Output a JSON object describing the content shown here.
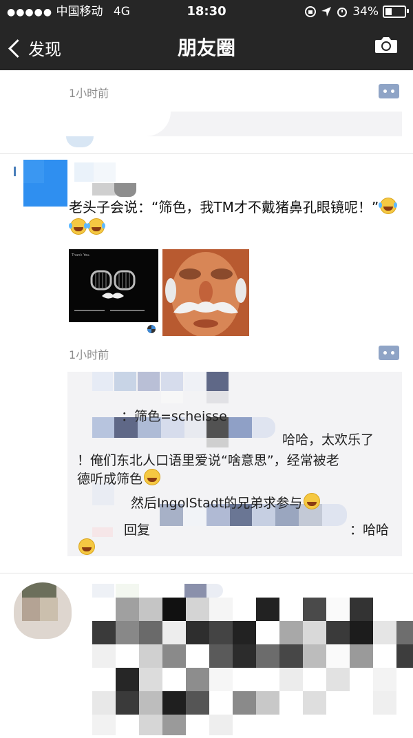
{
  "status_bar": {
    "signal": "●●●●●",
    "carrier": "中国移动",
    "network": "4G",
    "time": "18:30",
    "battery": "34%"
  },
  "nav": {
    "back_label": "发现",
    "title": "朋友圈",
    "camera_icon": "camera-icon"
  },
  "post1": {
    "time": "1小时前"
  },
  "post2": {
    "text": "老头子会说：“筛色，我TM才不戴猪鼻孔眼镜呢！”",
    "emojis": [
      "tears-of-joy",
      "tears-of-joy",
      "tears-of-joy"
    ],
    "time": "1小时前",
    "photo1_caption": "Thank You.",
    "comments": {
      "line1": "：筛色=scheisse",
      "line2": "哈哈，太欢乐了",
      "line3": "！俺们东北人口语里爱说“啥意思”，经常被老",
      "line4": "德听成筛色",
      "line5": "然后IngolStadt的兄弟求参与",
      "line6_reply": "回复",
      "line6_end": "：哈哈"
    }
  },
  "colors": {
    "bar_bg": "#262626",
    "mention": "#3d5c8c",
    "comment_bg": "#f3f3f5",
    "comment_button": "#8fa4c6"
  }
}
